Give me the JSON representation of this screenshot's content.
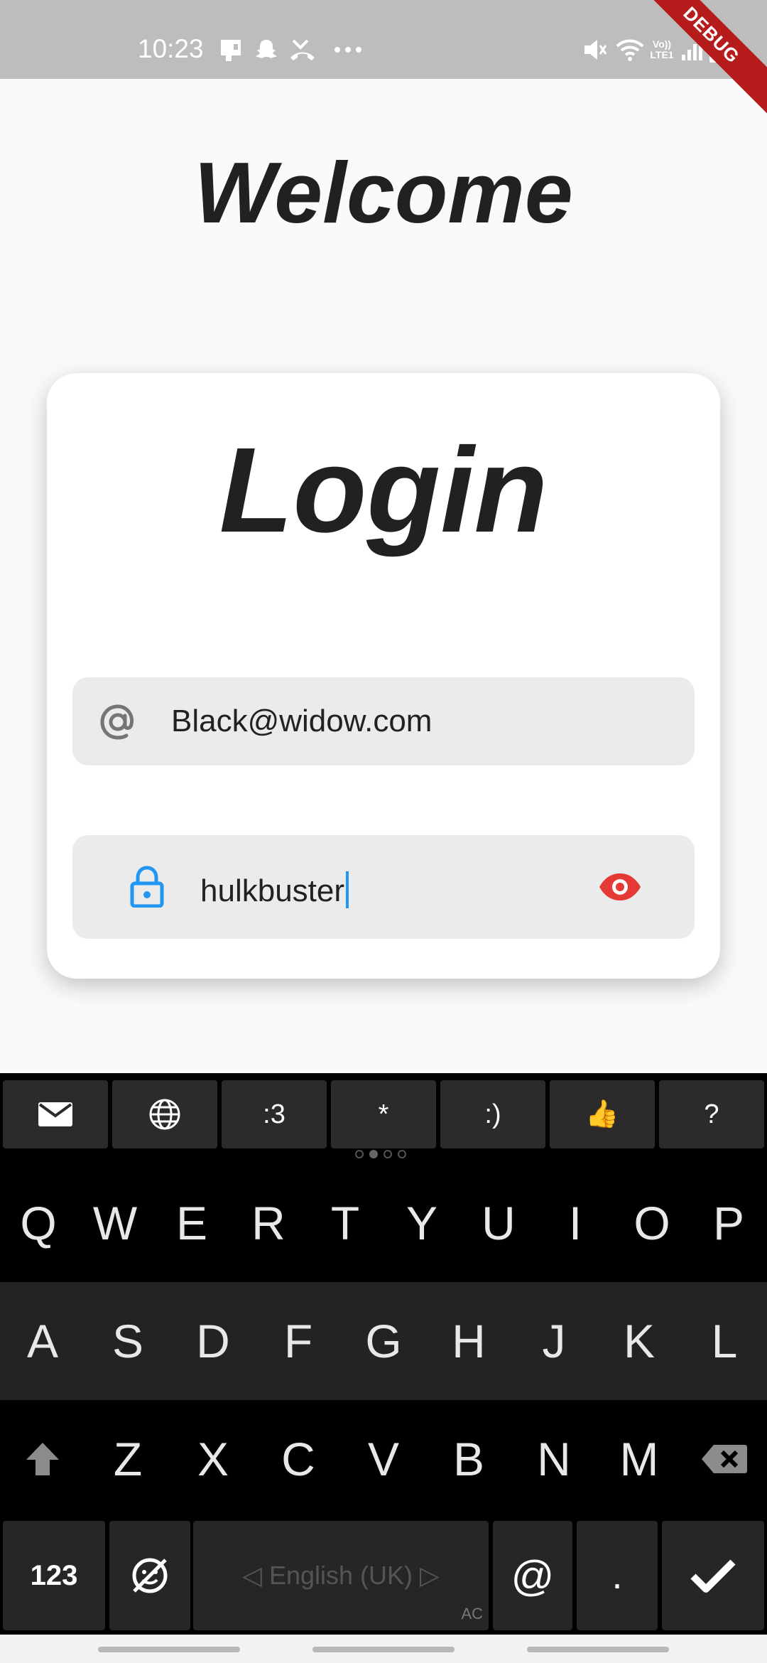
{
  "status_bar": {
    "time": "10:23",
    "debug_label": "DEBUG",
    "left_icons": [
      "notification-icon",
      "snapchat-icon",
      "missed-call-icon",
      "more-icon"
    ],
    "right_icons": [
      "mute-icon",
      "wifi-icon",
      "volte-icon",
      "signal-icon",
      "battery-icon"
    ],
    "volte_label": "Vo)) LTE1"
  },
  "page": {
    "welcome_title": "Welcome"
  },
  "login_card": {
    "title": "Login",
    "email_value": "Black@widow.com",
    "password_value": "hulkbuster",
    "email_icon": "at-icon",
    "password_icon": "lock-icon",
    "visibility_icon": "eye-icon"
  },
  "colors": {
    "lock_icon": "#2196f3",
    "eye_icon": "#e53935",
    "caret": "#2196f3",
    "debug_ribbon": "#b71c1c",
    "status_bar": "#bdbdbd"
  },
  "keyboard": {
    "suggestions": [
      "mail-icon",
      "globe-icon",
      ":3",
      "*",
      ":)",
      "👍",
      "?"
    ],
    "row1": [
      "Q",
      "W",
      "E",
      "R",
      "T",
      "Y",
      "U",
      "I",
      "O",
      "P"
    ],
    "row2": [
      "A",
      "S",
      "D",
      "F",
      "G",
      "H",
      "J",
      "K",
      "L"
    ],
    "row3": [
      "Z",
      "X",
      "C",
      "V",
      "B",
      "N",
      "M"
    ],
    "numbers_key": "123",
    "space_label": "◁ English (UK) ▷",
    "space_badge": "AC",
    "at_key": "@",
    "period_key": ".",
    "emoji_key_icon": "emoji-off-icon",
    "shift_icon": "shift-icon",
    "backspace_icon": "backspace-icon",
    "enter_icon": "checkmark-icon"
  }
}
